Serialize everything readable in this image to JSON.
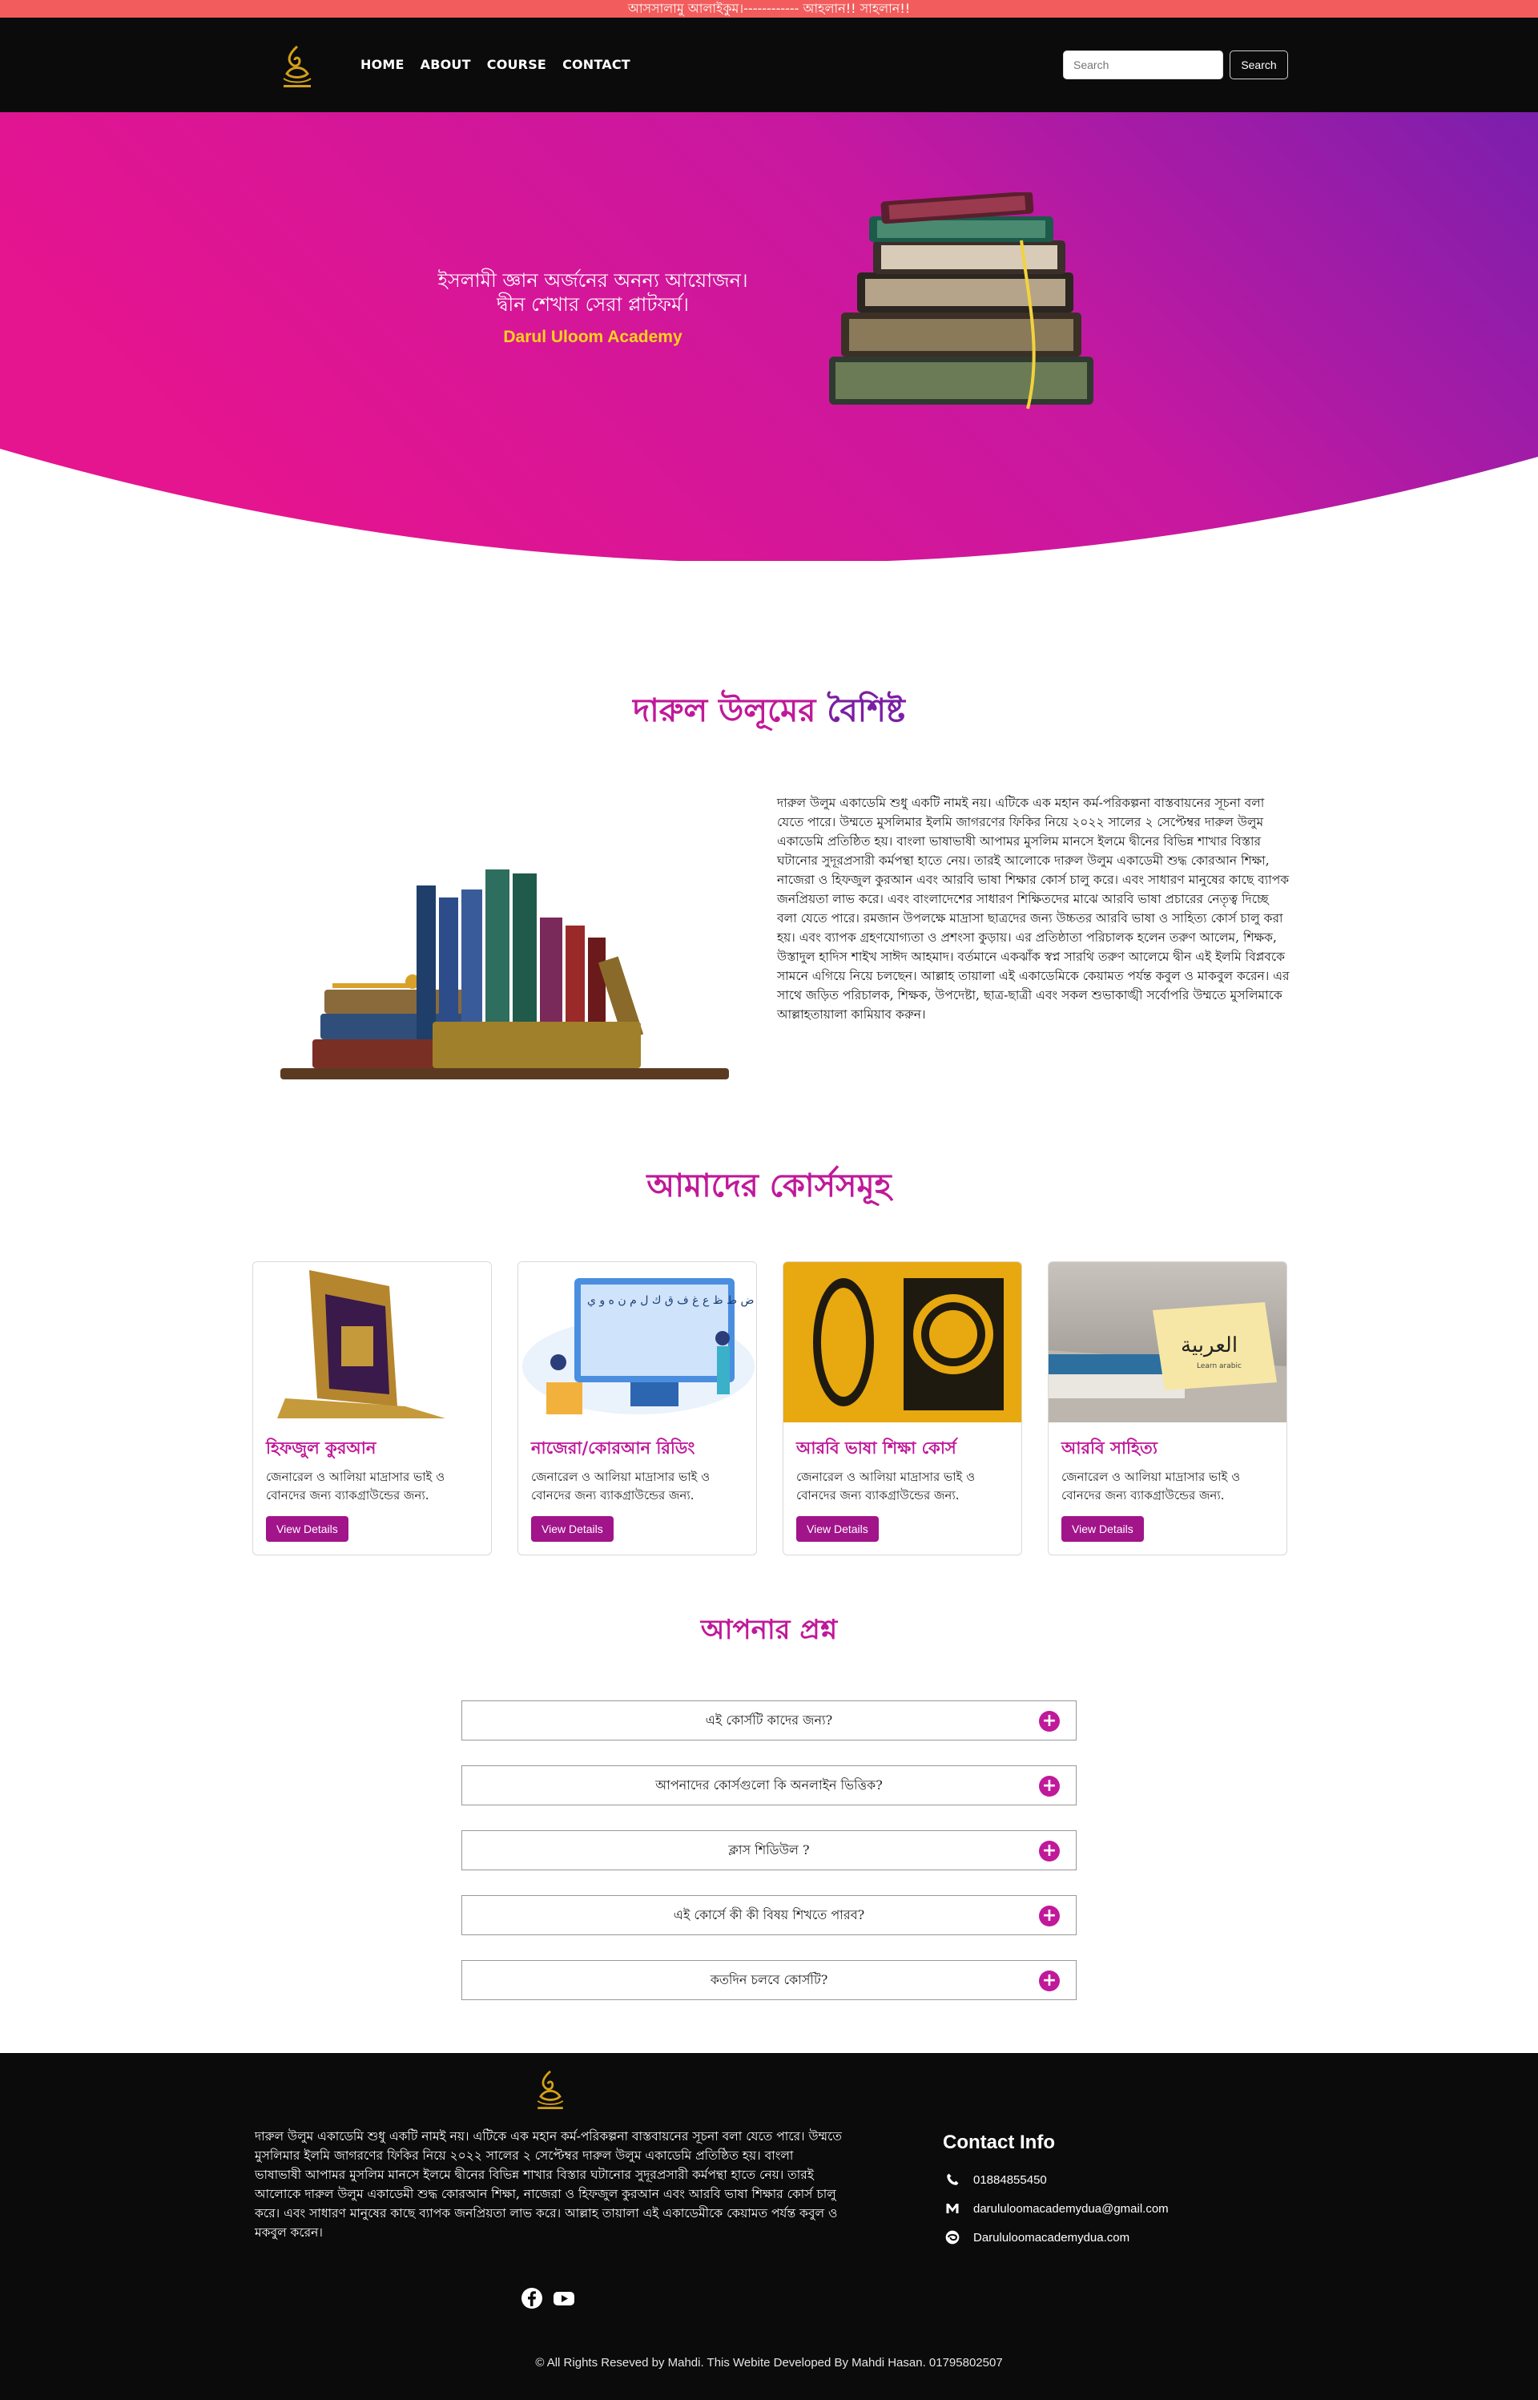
{
  "marquee": {
    "text": "আসসালামু আলাইকুম।------------ আহলান!! সাহলান!!"
  },
  "nav": {
    "links": [
      "HOME",
      "ABOUT",
      "COURSE",
      "CONTACT"
    ],
    "search_placeholder": "Search",
    "search_button": "Search"
  },
  "hero": {
    "headline": "ইসলামী জ্ঞান অর্জনের অনন্য আয়োজন। দ্বীন শেখার সেরা প্লাটফর্ম।",
    "brand": "Darul Uloom Academy"
  },
  "features": {
    "title_part1": "দারুল উলূমের",
    "title_part2": "বৈশিষ্ট",
    "body": "দারুল উলুম একাডেমি শুধু একটি নামই নয়। এটিকে এক মহান কর্ম-পরিকল্পনা বাস্তবায়নের সূচনা বলা যেতে পারে। উম্মতে মুসলিমার ইলমি জাগরণের ফিকির নিয়ে ২০২২ সালের ২ সেপ্টেম্বর দারুল উলুম একাডেমি প্রতিষ্ঠিত হয়। বাংলা ভাষাভাষী আপামর মুসলিম মানসে ইলমে দ্বীনের বিভিন্ন শাখার বিস্তার ঘটানোর সুদূরপ্রসারী কর্মপন্থা হাতে নেয়। তারই আলোকে দারুল উলুম একাডেমী শুদ্ধ কোরআন শিক্ষা, নাজেরা ও হিফজুল কুরআন এবং আরবি ভাষা শিক্ষার কোর্স চালু করে। এবং সাধারণ মানুষের কাছে ব্যাপক জনপ্রিয়তা লাভ করে। এবং বাংলাদেশের সাধারণ শিক্ষিতদের মাঝে আরবি ভাষা প্রচারের নেতৃত্ব দিচ্ছে বলা যেতে পারে। রমজান উপলক্ষে মাদ্রাসা ছাত্রদের জন্য উচ্চতর আরবি ভাষা ও সাহিত্য কোর্স চালু করা হয়। এবং ব্যাপক গ্রহণযোগ্যতা ও প্রশংসা কুড়ায়। এর প্রতিষ্ঠাতা পরিচালক হলেন তরুণ আলেম, শিক্ষক, উস্তাদুল হাদিস শাইখ সাঈদ আহমাদ। বর্তমানে একঝাঁক স্বপ্ন সারথি তরুণ আলেমে দ্বীন এই ইলমি বিপ্লবকে সামনে এগিয়ে নিয়ে চলছেন। আল্লাহ তায়ালা এই একাডেমিকে কেয়ামত পর্যন্ত কবুল ও মাকবুল করেন। এর সাথে জড়িত পরিচালক, শিক্ষক, উপদেষ্টা, ছাত্র-ছাত্রী এবং সকল শুভাকাঙ্খী সর্বোপরি উম্মতে মুসলিমাকে আল্লাহতায়ালা কামিয়াব করুন।"
  },
  "courses": {
    "title": "আমাদের কোর্সসমূহ",
    "items": [
      {
        "title": "হিফজুল কুরআন",
        "desc": "জেনারেল ও আলিয়া মাদ্রাসার ভাই ও বোনদের জন্য ব্যাকগ্রাউন্ডের জন্য.",
        "button": "View Details"
      },
      {
        "title": "নাজেরা/কোরআন রিডিং",
        "desc": "জেনারেল ও আলিয়া মাদ্রাসার ভাই ও বোনদের জন্য ব্যাকগ্রাউন্ডের জন্য.",
        "button": "View Details"
      },
      {
        "title": "আরবি ভাষা শিক্ষা কোর্স",
        "desc": "জেনারেল ও আলিয়া মাদ্রাসার ভাই ও বোনদের জন্য ব্যাকগ্রাউন্ডের জন্য.",
        "button": "View Details"
      },
      {
        "title": "আরবি সাহিত্য",
        "desc": "জেনারেল ও আলিয়া মাদ্রাসার ভাই ও বোনদের জন্য ব্যাকগ্রাউন্ডের জন্য.",
        "button": "View Details"
      }
    ],
    "image_texts": {
      "alphabet": "ا ب ت ث ج ح خ د ذ ر ز س ش ص ض ط ظ ع غ ف ق ك ل م ن ه و ي",
      "arabic_card": "العربية",
      "arabic_card_sub": "Learn arabic"
    }
  },
  "faq": {
    "title": "আপনার প্রশ্ন",
    "items": [
      "এই কোর্সটি কাদের জন্য?",
      "আপনাদের কোর্সগুলো কি অনলাইন ভিত্তিক?",
      "ক্লাস শিডিউল ?",
      "এই কোর্সে কী কী বিষয় শিখতে পারব?",
      "কতদিন চলবে কোর্সটি?"
    ]
  },
  "footer": {
    "about": "দারুল উলুম একাডেমি শুধু একটি নামই নয়। এটিকে এক মহান কর্ম-পরিকল্পনা বাস্তবায়নের সূচনা বলা যেতে পারে। উম্মতে মুসলিমার ইলমি জাগরণের ফিকির নিয়ে ২০২২ সালের ২ সেপ্টেম্বর দারুল উলুম একাডেমি প্রতিষ্ঠিত হয়। বাংলা ভাষাভাষী আপামর মুসলিম মানসে ইলমে দ্বীনের বিভিন্ন শাখার বিস্তার ঘটানোর সুদূরপ্রসারী কর্মপন্থা হাতে নেয়। তারই আলোকে দারুল উলুম একাডেমী শুদ্ধ কোরআন শিক্ষা, নাজেরা ও হিফজুল কুরআন এবং আরবি ভাষা শিক্ষার কোর্স চালু করে। এবং সাধারণ মানুষের কাছে ব্যাপক জনপ্রিয়তা লাভ করে। আল্লাহ তায়ালা এই একাডেমীকে কেয়ামত পর্যন্ত কবুল ও মকবুল করেন।",
    "contact_title": "Contact Info",
    "phone": "01884855450",
    "email": "darululoomacademydua@gmail.com",
    "website": "Darululoomacademydua.com",
    "copyright": "© All Rights Reseved by Mahdi.  This Webite Developed By Mahdi Hasan.  01795802507"
  },
  "colors": {
    "accent": "#c0199a",
    "accent_purple": "#7b1fa2",
    "brand_yellow": "#ffd21a",
    "topbar": "#f25c5c",
    "navbar": "#0b0b0b"
  },
  "icons": [
    "logo-icon",
    "phone-icon",
    "email-icon",
    "web-icon",
    "facebook-icon",
    "youtube-icon",
    "plus-icon"
  ]
}
